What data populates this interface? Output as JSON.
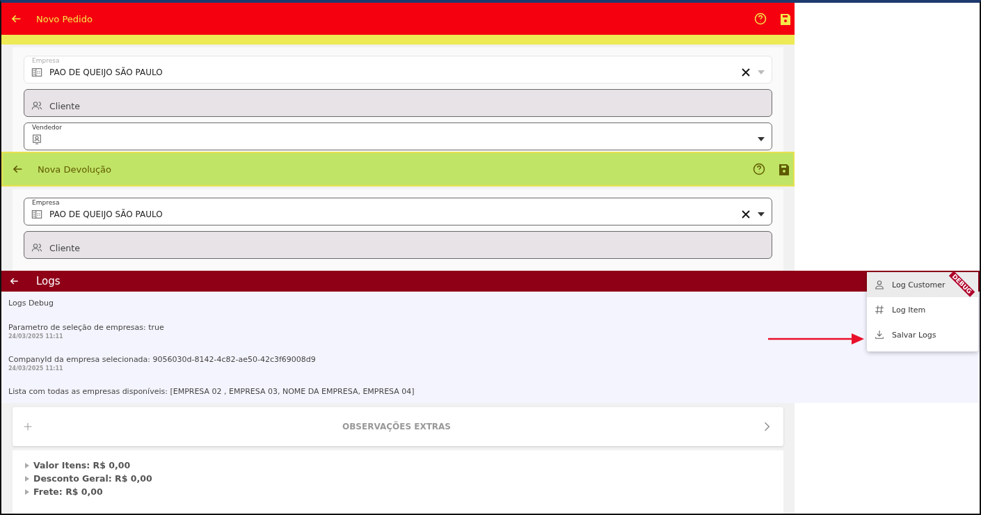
{
  "order_screen": {
    "title": "Novo Pedido",
    "fields": [
      {
        "kind": "company",
        "label": "Empresa",
        "value": "PAO DE QUEIJO SÃO PAULO",
        "disabled": true
      },
      {
        "kind": "customer",
        "placeholder": "Cliente",
        "disabled": false
      },
      {
        "kind": "seller",
        "label": "Vendedor",
        "disabled": false
      }
    ]
  },
  "return_screen": {
    "title": "Nova Devolução",
    "fields": [
      {
        "kind": "company",
        "label": "Empresa",
        "value": "PAO DE QUEIJO SÃO PAULO",
        "disabled": false
      },
      {
        "kind": "customer",
        "placeholder": "Cliente",
        "disabled": false
      }
    ]
  },
  "logs_screen": {
    "title": "Logs",
    "heading": "Logs Debug",
    "ribbon": "DEBUG",
    "entries": [
      {
        "message": "Parametro de seleção de empresas: true",
        "timestamp": "24/03/2025 11:11"
      },
      {
        "message": "CompanyId da empresa selecionada: 9056030d-8142-4c82-ae50-42c3f69008d9",
        "timestamp": "24/03/2025 11:11"
      },
      {
        "message": "Lista com todas as empresas disponíveis: [EMPRESA 02 , EMPRESA 03, NOME DA EMPRESA, EMPRESA 04]"
      }
    ],
    "menu": [
      {
        "kind": "customer",
        "label": "Log Customer",
        "selected": true
      },
      {
        "kind": "item",
        "label": "Log Item",
        "selected": false
      },
      {
        "kind": "save",
        "label": "Salvar Logs",
        "selected": false
      }
    ]
  },
  "summary": {
    "section_title": "OBSERVAÇÕES EXTRAS",
    "totals": [
      {
        "label": "Valor Itens: R$ 0,00"
      },
      {
        "label": "Desconto Geral: R$ 0,00"
      },
      {
        "label": "Frete: R$ 0,00"
      }
    ]
  }
}
